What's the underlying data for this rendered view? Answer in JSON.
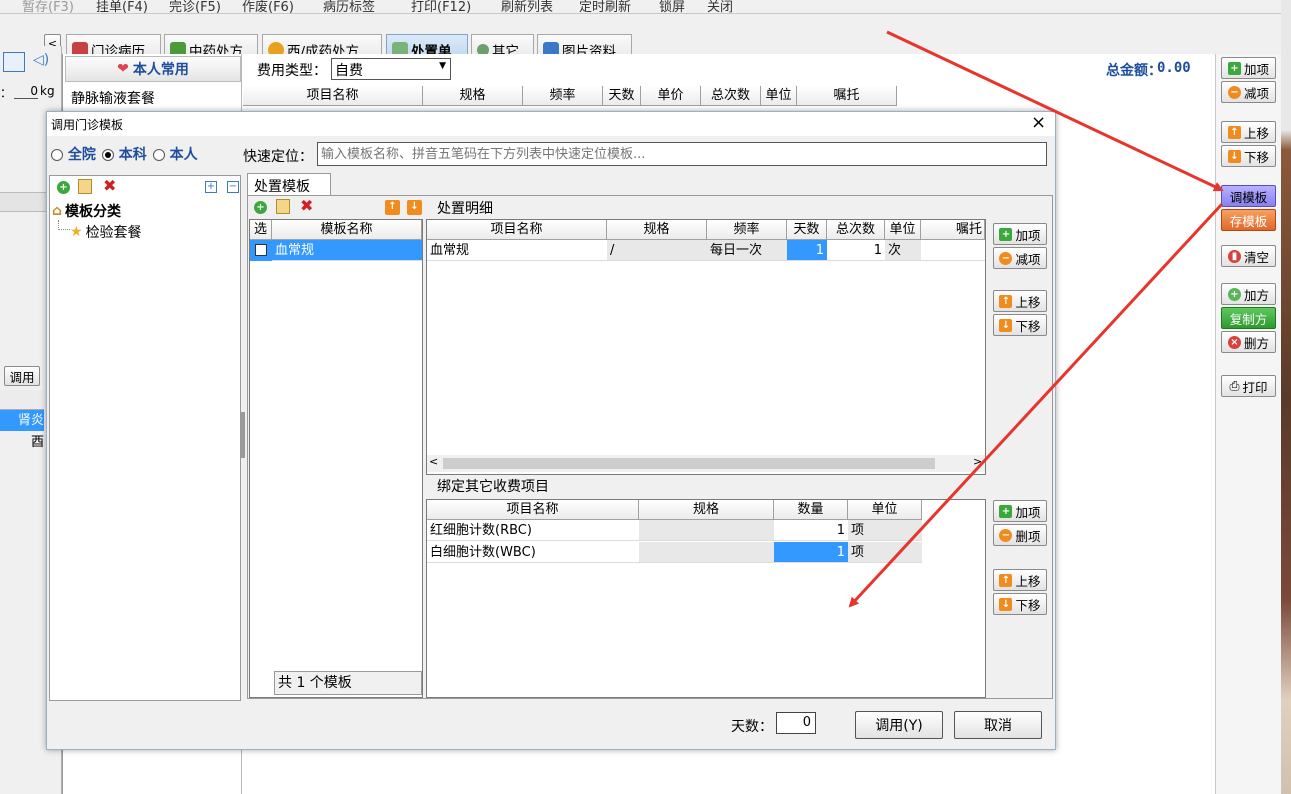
{
  "menu": [
    "暂存(F3)",
    "挂单(F4)",
    "完诊(F5)",
    "作废(F6)",
    "病历标签",
    "打印(F12)",
    "刷新列表",
    "定时刷新",
    "锁屏",
    "关闭"
  ],
  "tabs": [
    "门诊病历",
    "中药处方",
    "西/成药处方",
    "处置单",
    "其它",
    "图片资料"
  ],
  "bg": {
    "common_title": "本人常用",
    "common_item": "静脉输液套餐",
    "fee_type_label": "费用类型：",
    "fee_type_value": "自费",
    "total_label": "总金额：",
    "total_value": "0.00",
    "columns": [
      "项目名称",
      "规格",
      "频率",
      "天数",
      "单价",
      "总次数",
      "单位",
      "嘱托"
    ],
    "weight_label": "：",
    "weight_value": "0",
    "weight_unit": "kg",
    "call_btn": "调用",
    "left_rows": [
      "肾炎",
      "酉"
    ]
  },
  "right_buttons": {
    "add": "加项",
    "remove": "减项",
    "up": "上移",
    "down": "下移",
    "call_template": "调模板",
    "save_template": "存模板",
    "clear": "清空",
    "add_rx": "加方",
    "copy_rx": "复制方",
    "delete_rx": "删方",
    "print": "打印"
  },
  "dialog": {
    "title": "调用门诊模板",
    "close": "×",
    "scope_options": [
      "全院",
      "本科",
      "本人"
    ],
    "scope_selected": "本科",
    "quick_label": "快速定位：",
    "quick_placeholder": "输入模板名称、拼音五笔码在下方列表中快速定位模板...",
    "tree_root": "模板分类",
    "tree_child": "检验套餐",
    "tab_label": "处置模板",
    "template_list": {
      "headers": [
        "选",
        "模板名称"
      ],
      "rows": [
        {
          "name": "血常规"
        }
      ],
      "footer": "共 1 个模板"
    },
    "detail": {
      "title": "处置明细",
      "headers": [
        "项目名称",
        "规格",
        "频率",
        "天数",
        "总次数",
        "单位",
        "嘱托"
      ],
      "rows": [
        {
          "name": "血常规",
          "spec": "/",
          "freq": "每日一次",
          "days": "1",
          "total": "1",
          "unit": "次",
          "note": ""
        }
      ]
    },
    "bind": {
      "title": "绑定其它收费项目",
      "headers": [
        "项目名称",
        "规格",
        "数量",
        "单位"
      ],
      "rows": [
        {
          "name": "红细胞计数(RBC)",
          "spec": "",
          "qty": "1",
          "unit": "项"
        },
        {
          "name": "白细胞计数(WBC)",
          "spec": "",
          "qty": "1",
          "unit": "项"
        }
      ]
    },
    "side_buttons": {
      "add": "加项",
      "remove": "减项",
      "up": "上移",
      "down": "下移",
      "delete": "删项"
    },
    "days_label": "天数：",
    "days_value": "0",
    "ok": "调用(Y)",
    "cancel": "取消"
  },
  "colors": {
    "accent": "#3399ff",
    "arrow": "#e8352c",
    "title_blue": "#1f4e9c"
  }
}
